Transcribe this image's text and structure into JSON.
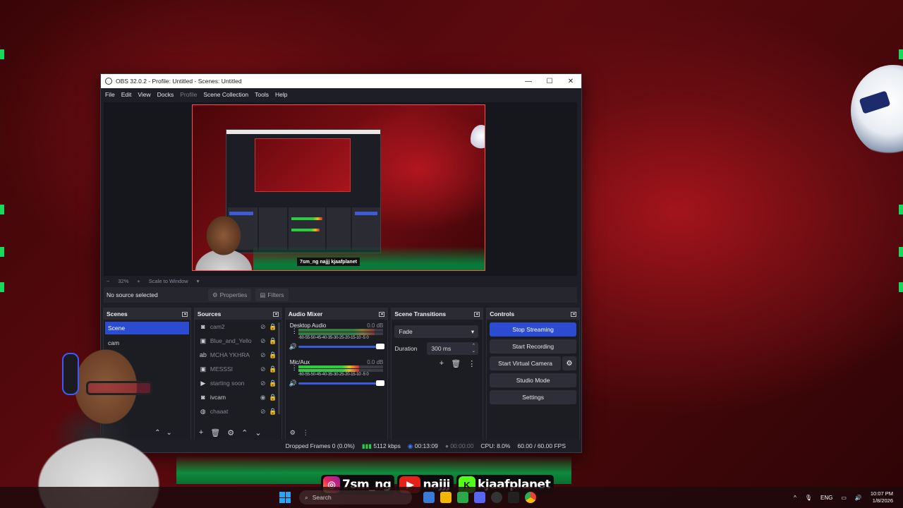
{
  "window": {
    "title": "OBS 32.0.2 - Profile: Untitled - Scenes: Untitled",
    "minimize": "—",
    "maximize": "☐",
    "close": "✕"
  },
  "menu": [
    "File",
    "Edit",
    "View",
    "Docks",
    "Profile",
    "Scene Collection",
    "Tools",
    "Help"
  ],
  "preview": {
    "zoom": "32%",
    "scale_mode": "Scale to Window",
    "zoom_out": "−",
    "zoom_in": "+",
    "overlay_text": "7sm_ng najjj kjaafplanet"
  },
  "source_bar": {
    "no_source": "No source selected",
    "properties": "Properties",
    "filters": "Filters"
  },
  "scenes": {
    "header": "Scenes",
    "items": [
      "Scene",
      "cam"
    ]
  },
  "sources": {
    "header": "Sources",
    "items": [
      {
        "name": "cam2",
        "icon": "camera-icon",
        "visible": false
      },
      {
        "name": "Blue_and_Yello",
        "icon": "image-icon",
        "visible": false
      },
      {
        "name": "MCHA YKHRA",
        "icon": "text-icon",
        "visible": false
      },
      {
        "name": "MESSSI",
        "icon": "image-icon",
        "visible": false
      },
      {
        "name": "starting soon",
        "icon": "play-icon",
        "visible": false
      },
      {
        "name": "ivcam",
        "icon": "camera-icon",
        "visible": true
      },
      {
        "name": "chaaat",
        "icon": "browser-icon",
        "visible": false
      }
    ]
  },
  "mixer": {
    "header": "Audio Mixer",
    "channels": [
      {
        "name": "Desktop Audio",
        "db": "0.0 dB",
        "level": 0.0
      },
      {
        "name": "Mic/Aux",
        "db": "0.0 dB",
        "level": 0.72
      }
    ],
    "scale": "-60-55-50-45-40-35-30-25-20-15-10 -5  0"
  },
  "transitions": {
    "header": "Scene Transitions",
    "selected": "Fade",
    "duration_label": "Duration",
    "duration_value": "300 ms"
  },
  "controls": {
    "header": "Controls",
    "stop_streaming": "Stop Streaming",
    "start_recording": "Start Recording",
    "start_virtual_camera": "Start Virtual Camera",
    "studio_mode": "Studio Mode",
    "settings": "Settings"
  },
  "status": {
    "dropped_frames": "Dropped Frames 0 (0.0%)",
    "bitrate": "5112 kbps",
    "stream_time": "00:13:09",
    "record_time": "00:00:00",
    "cpu": "CPU: 8.0%",
    "fps": "60.00 / 60.00 FPS"
  },
  "social": {
    "instagram": "7sm_ng",
    "youtube": "najjj",
    "kick": "kjaafplanet"
  },
  "taskbar": {
    "search": "Search",
    "lang": "ENG",
    "time": "10:07 PM",
    "date": "1/8/2026"
  },
  "colors": {
    "accent": "#2b4bd1",
    "meter_green": "#2ecc40",
    "meter_yellow": "#e0c021",
    "meter_red": "#d02b2b"
  }
}
